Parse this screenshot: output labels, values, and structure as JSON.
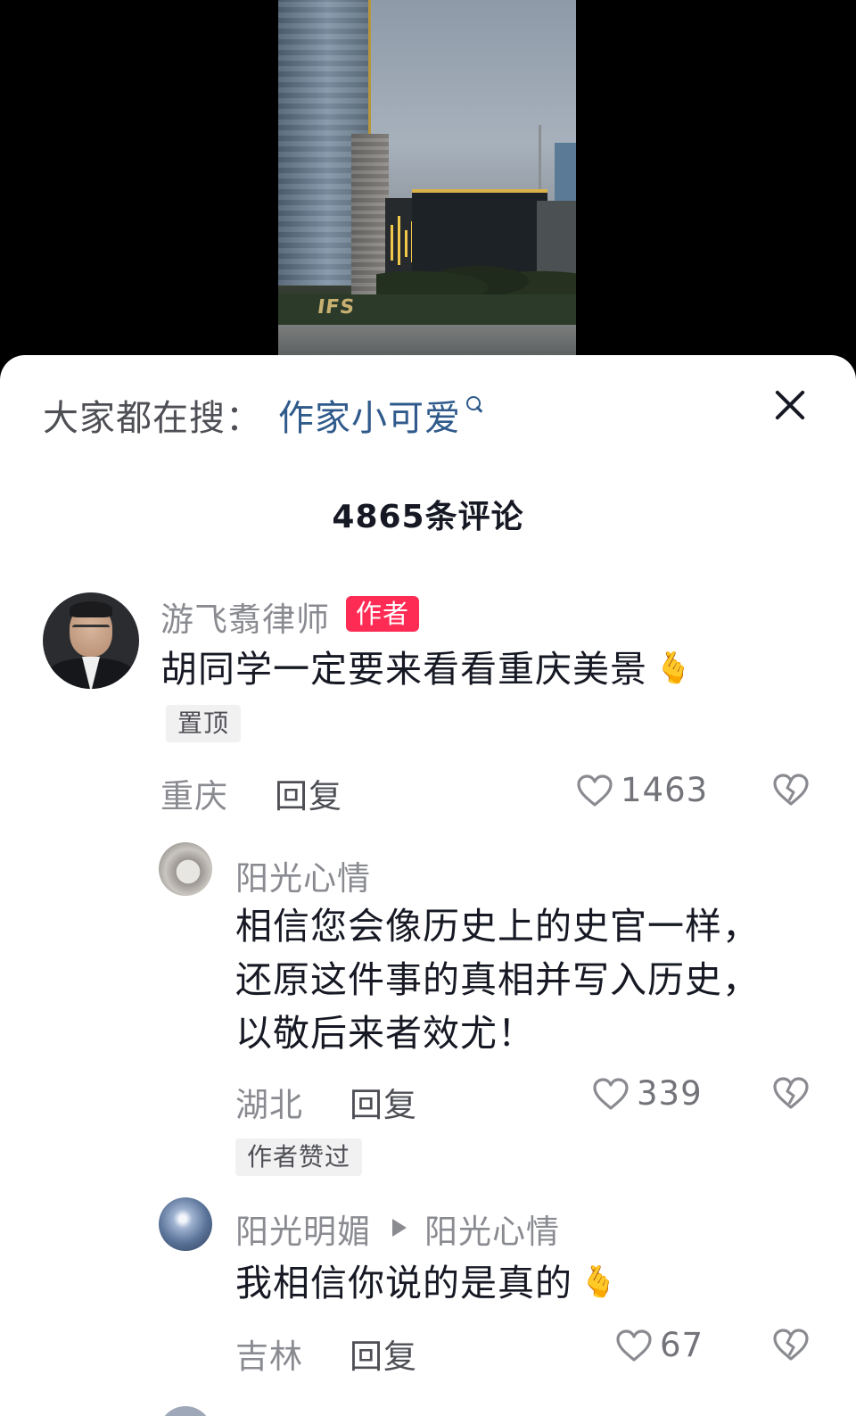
{
  "search_bar": {
    "prefix": "大家都在搜：",
    "term": "作家小可爱",
    "icon": "search-icon"
  },
  "header": {
    "comment_count_label": "4865条评论",
    "close_icon": "close-icon"
  },
  "comments": [
    {
      "username": "游飞翥律师",
      "badge": "作者",
      "text": "胡同学一定要来看看重庆美景",
      "emoji": "🫰",
      "tag": "置顶",
      "location": "重庆",
      "reply_label": "回复",
      "likes": "1463",
      "avatar": "avatar-lawyer"
    }
  ],
  "replies": [
    {
      "username": "阳光心情",
      "text_lines": [
        "相信您会像历史上的史官一样，",
        "还原这件事的真相并写入历史，",
        "以敬后来者效尤！"
      ],
      "location": "湖北",
      "reply_label": "回复",
      "likes": "339",
      "tag": "作者赞过",
      "avatar": "avatar-cat"
    },
    {
      "username": "阳光明媚",
      "reply_to": "阳光心情",
      "text": "我相信你说的是真的",
      "emoji": "🫰",
      "location": "吉林",
      "reply_label": "回复",
      "likes": "67",
      "avatar": "avatar-sky"
    }
  ],
  "colors": {
    "accent_link": "#2f5a8b",
    "badge_red": "#fe2c55",
    "text_primary": "#161823",
    "text_secondary": "#8a8b91"
  }
}
